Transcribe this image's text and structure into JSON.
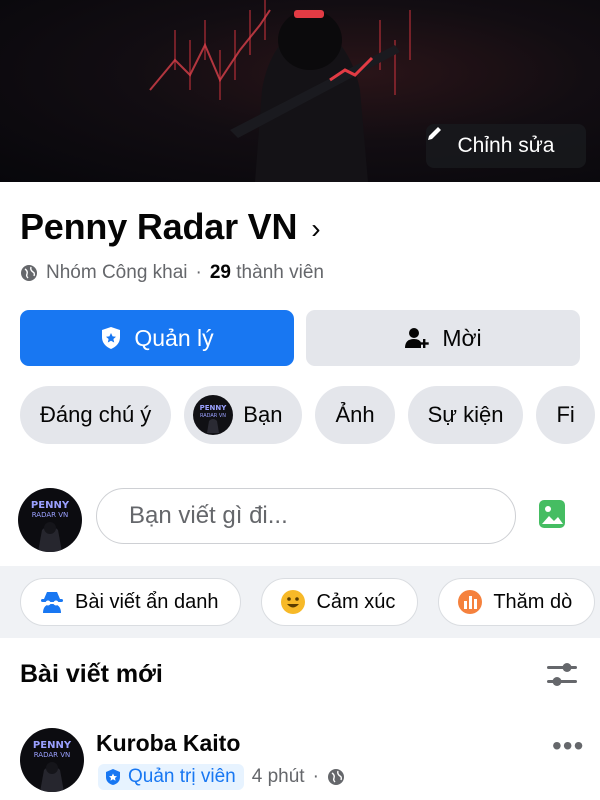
{
  "cover": {
    "edit_label": "Chỉnh sửa"
  },
  "group": {
    "name": "Penny Radar VN",
    "privacy": "Nhóm Công khai",
    "separator": "·",
    "member_count": "29",
    "member_label": "thành viên"
  },
  "actions": {
    "manage_label": "Quản lý",
    "invite_label": "Mời"
  },
  "tabs": [
    {
      "label": "Đáng chú ý"
    },
    {
      "label": "Bạn"
    },
    {
      "label": "Ảnh"
    },
    {
      "label": "Sự kiện"
    },
    {
      "label": "Fi"
    }
  ],
  "composer": {
    "placeholder": "Bạn viết gì đi..."
  },
  "chips": [
    {
      "label": "Bài viết ẩn danh",
      "icon": "anonymous-icon"
    },
    {
      "label": "Cảm xúc",
      "icon": "smile-icon"
    },
    {
      "label": "Thăm dò",
      "icon": "poll-icon"
    }
  ],
  "section": {
    "title": "Bài viết mới"
  },
  "post": {
    "author": "Kuroba Kaito",
    "role": "Quản trị viên",
    "time": "4 phút",
    "separator": "·",
    "more": "•••"
  },
  "avatar_text": {
    "line1": "PENNY",
    "line2": "RADAR VN"
  },
  "colors": {
    "primary": "#1877f2",
    "secondary_bg": "#e4e6eb",
    "muted_text": "#65676b",
    "band_bg": "#f0f2f5"
  }
}
